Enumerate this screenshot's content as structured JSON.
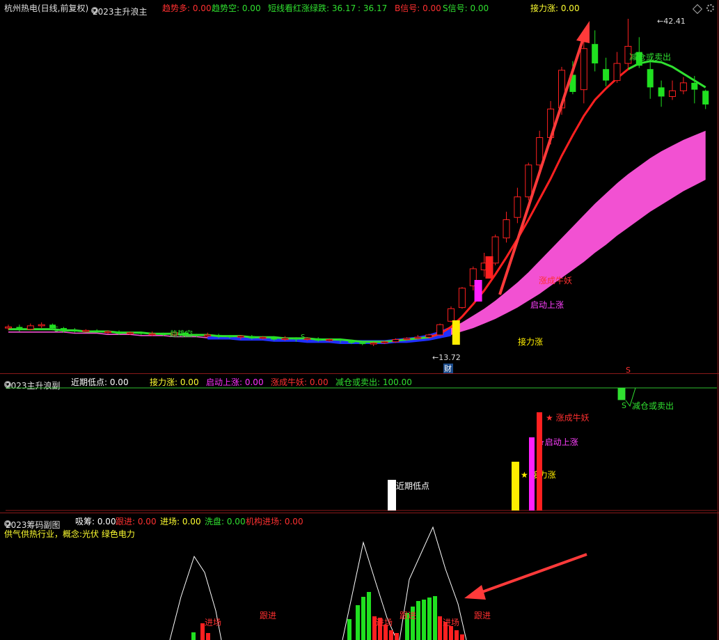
{
  "pane_main": {
    "title": "杭州热电(日线,前复权)",
    "indicator": "2023主升浪主",
    "fields": [
      {
        "label": "趋势多: 0.00",
        "color": "#ff3030"
      },
      {
        "label": "趋势空: 0.00",
        "color": "#30e030"
      },
      {
        "label": "短线看红涨绿跌: 36.17",
        "color": "#30e030"
      },
      {
        "label": ": 36.17",
        "color": "#30e030"
      },
      {
        "label": "B信号: 0.00",
        "color": "#ff3030"
      },
      {
        "label": "S信号: 0.00",
        "color": "#30e030"
      },
      {
        "label": "接力涨: 0.00",
        "color": "#ffff30"
      }
    ],
    "high_label": "42.41",
    "low_label": "13.72",
    "cai_label": "财",
    "annotations": {
      "jieli": "接力涨",
      "qidong": "启动上涨",
      "zhangcheng": "涨成牛妖",
      "jiancang": "减仓或卖出",
      "qushi_kong": "趋势空",
      "s_mark": "S",
      "s_mark2": "S"
    }
  },
  "pane_mid": {
    "indicator": "2023主升浪副",
    "fields": [
      {
        "label": "近期低点: 0.00",
        "color": "#ffffff"
      },
      {
        "label": "接力涨: 0.00",
        "color": "#ffff30"
      },
      {
        "label": "启动上涨: 0.00",
        "color": "#ff30ff"
      },
      {
        "label": "涨成牛妖: 0.00",
        "color": "#ff3030"
      },
      {
        "label": "减仓或卖出: 100.00",
        "color": "#30e030"
      }
    ],
    "bar_labels": {
      "low": "近期低点",
      "jieli": "★ 接力涨",
      "qidong": "★启动上涨",
      "zhangcheng": "★ 涨成牛妖",
      "jiancang": "减仓或卖出",
      "s": "S"
    }
  },
  "pane_low": {
    "indicator": "2023筹码副图",
    "fields": [
      {
        "label": "吸筹: 0.00",
        "color": "#ffffff"
      },
      {
        "label": "跟进: 0.00",
        "color": "#ff3030"
      },
      {
        "label": "进场: 0.00",
        "color": "#ffff30"
      },
      {
        "label": "洗盘: 0.00",
        "color": "#30e030"
      },
      {
        "label": "机构进场: 0.00",
        "color": "#ff3030"
      }
    ],
    "concept": "供气供热行业，概念:光伏 绿色电力",
    "marks": {
      "jinchang": "进场",
      "genjin": "跟进"
    }
  },
  "chart_data": {
    "type": "candlestick",
    "title": "杭州热电(日线,前复权)",
    "y_low": 13.72,
    "y_high": 42.41,
    "colors": {
      "up": "#ff2020",
      "down": "#20e020",
      "pink": "#ff55dd",
      "blue": "#2030ff",
      "yellow": "#ffee00",
      "magenta": "#ff20ff"
    },
    "candles": [
      {
        "o": 15.3,
        "c": 15.4,
        "h": 15.6,
        "l": 15.1
      },
      {
        "o": 15.4,
        "c": 15.2,
        "h": 15.6,
        "l": 15.0
      },
      {
        "o": 15.2,
        "c": 15.5,
        "h": 15.7,
        "l": 15.1
      },
      {
        "o": 15.5,
        "c": 15.6,
        "h": 15.8,
        "l": 15.3
      },
      {
        "o": 15.6,
        "c": 15.3,
        "h": 15.7,
        "l": 15.1
      },
      {
        "o": 15.3,
        "c": 15.1,
        "h": 15.4,
        "l": 14.9
      },
      {
        "o": 15.1,
        "c": 15.0,
        "h": 15.3,
        "l": 14.9
      },
      {
        "o": 15.0,
        "c": 15.1,
        "h": 15.2,
        "l": 14.9
      },
      {
        "o": 15.1,
        "c": 15.0,
        "h": 15.2,
        "l": 14.9
      },
      {
        "o": 15.0,
        "c": 15.0,
        "h": 15.1,
        "l": 14.8
      },
      {
        "o": 15.0,
        "c": 14.8,
        "h": 15.1,
        "l": 14.7
      },
      {
        "o": 14.8,
        "c": 14.9,
        "h": 15.0,
        "l": 14.7
      },
      {
        "o": 14.9,
        "c": 14.8,
        "h": 15.0,
        "l": 14.7
      },
      {
        "o": 14.8,
        "c": 14.8,
        "h": 15.0,
        "l": 14.6
      },
      {
        "o": 14.8,
        "c": 14.7,
        "h": 14.9,
        "l": 14.6
      },
      {
        "o": 14.7,
        "c": 14.9,
        "h": 15.0,
        "l": 14.6
      },
      {
        "o": 14.9,
        "c": 14.7,
        "h": 15.0,
        "l": 14.5
      },
      {
        "o": 14.7,
        "c": 14.6,
        "h": 14.8,
        "l": 14.5
      },
      {
        "o": 14.6,
        "c": 14.7,
        "h": 14.9,
        "l": 14.5
      },
      {
        "o": 14.7,
        "c": 14.6,
        "h": 14.8,
        "l": 14.4
      },
      {
        "o": 14.6,
        "c": 14.5,
        "h": 14.7,
        "l": 14.4
      },
      {
        "o": 14.5,
        "c": 14.6,
        "h": 14.7,
        "l": 14.3
      },
      {
        "o": 14.6,
        "c": 14.4,
        "h": 14.7,
        "l": 14.3
      },
      {
        "o": 14.4,
        "c": 14.5,
        "h": 14.6,
        "l": 14.3
      },
      {
        "o": 14.5,
        "c": 14.3,
        "h": 14.6,
        "l": 14.2
      },
      {
        "o": 14.3,
        "c": 14.4,
        "h": 14.6,
        "l": 14.2
      },
      {
        "o": 14.4,
        "c": 14.3,
        "h": 14.5,
        "l": 14.1
      },
      {
        "o": 14.3,
        "c": 14.4,
        "h": 14.5,
        "l": 14.2
      },
      {
        "o": 14.4,
        "c": 14.2,
        "h": 14.5,
        "l": 14.1
      },
      {
        "o": 14.2,
        "c": 14.3,
        "h": 14.4,
        "l": 14.1
      },
      {
        "o": 14.3,
        "c": 14.2,
        "h": 14.4,
        "l": 14.0
      },
      {
        "o": 14.2,
        "c": 14.0,
        "h": 14.3,
        "l": 13.9
      },
      {
        "o": 14.0,
        "c": 13.9,
        "h": 14.1,
        "l": 13.8
      },
      {
        "o": 13.9,
        "c": 14.0,
        "h": 14.1,
        "l": 13.72
      },
      {
        "o": 14.0,
        "c": 14.1,
        "h": 14.2,
        "l": 13.9
      },
      {
        "o": 14.1,
        "c": 14.3,
        "h": 14.4,
        "l": 14.0
      },
      {
        "o": 14.3,
        "c": 14.4,
        "h": 14.5,
        "l": 14.2
      },
      {
        "o": 14.4,
        "c": 14.5,
        "h": 14.7,
        "l": 14.3
      },
      {
        "o": 14.5,
        "c": 14.7,
        "h": 14.8,
        "l": 14.4
      },
      {
        "o": 14.7,
        "c": 15.6,
        "h": 15.7,
        "l": 14.6
      },
      {
        "o": 15.9,
        "c": 17.0,
        "h": 17.2,
        "l": 15.8
      },
      {
        "o": 17.1,
        "c": 18.8,
        "h": 18.9,
        "l": 17.0
      },
      {
        "o": 19.0,
        "c": 20.5,
        "h": 20.7,
        "l": 18.6
      },
      {
        "o": 20.4,
        "c": 21.0,
        "h": 21.9,
        "l": 19.8
      },
      {
        "o": 21.0,
        "c": 23.3,
        "h": 23.5,
        "l": 20.8
      },
      {
        "o": 23.2,
        "c": 24.8,
        "h": 25.5,
        "l": 22.8
      },
      {
        "o": 25.0,
        "c": 26.8,
        "h": 27.6,
        "l": 24.5
      },
      {
        "o": 26.8,
        "c": 29.6,
        "h": 29.8,
        "l": 26.5
      },
      {
        "o": 29.6,
        "c": 32.0,
        "h": 32.6,
        "l": 29.0
      },
      {
        "o": 32.0,
        "c": 34.5,
        "h": 35.2,
        "l": 31.4
      },
      {
        "o": 34.6,
        "c": 37.9,
        "h": 38.2,
        "l": 34.0
      },
      {
        "o": 37.5,
        "c": 36.0,
        "h": 38.7,
        "l": 35.8
      },
      {
        "o": 36.2,
        "c": 39.8,
        "h": 41.3,
        "l": 35.0
      },
      {
        "o": 40.2,
        "c": 38.5,
        "h": 41.4,
        "l": 37.8
      },
      {
        "o": 38.0,
        "c": 37.0,
        "h": 39.0,
        "l": 36.5
      },
      {
        "o": 37.0,
        "c": 38.5,
        "h": 39.5,
        "l": 36.8
      },
      {
        "o": 38.5,
        "c": 40.0,
        "h": 42.41,
        "l": 38.0
      },
      {
        "o": 39.5,
        "c": 38.3,
        "h": 40.8,
        "l": 38.1
      },
      {
        "o": 38.0,
        "c": 36.4,
        "h": 38.6,
        "l": 35.4
      },
      {
        "o": 36.4,
        "c": 35.6,
        "h": 37.0,
        "l": 34.7
      },
      {
        "o": 35.6,
        "c": 36.1,
        "h": 37.0,
        "l": 35.3
      },
      {
        "o": 36.1,
        "c": 36.8,
        "h": 37.3,
        "l": 35.8
      },
      {
        "o": 36.8,
        "c": 36.2,
        "h": 37.4,
        "l": 35.0
      },
      {
        "o": 36.1,
        "c": 34.9,
        "h": 36.2,
        "l": 34.5
      }
    ],
    "ma": [
      15.2,
      15.2,
      15.2,
      15.2,
      15.2,
      15.1,
      15.1,
      15.0,
      15.0,
      15.0,
      14.9,
      14.9,
      14.9,
      14.8,
      14.8,
      14.8,
      14.7,
      14.7,
      14.7,
      14.6,
      14.6,
      14.6,
      14.5,
      14.5,
      14.5,
      14.4,
      14.4,
      14.4,
      14.3,
      14.3,
      14.3,
      14.2,
      14.1,
      14.1,
      14.1,
      14.2,
      14.3,
      14.4,
      14.5,
      14.8,
      15.4,
      16.3,
      17.4,
      18.6,
      20.0,
      21.5,
      23.1,
      24.8,
      26.6,
      28.4,
      30.4,
      32.2,
      33.9,
      35.3,
      36.3,
      37.2,
      38.0,
      38.5,
      38.7,
      38.6,
      38.2,
      37.6,
      37.0,
      36.4
    ],
    "pink_upper": [
      15.0,
      15.0,
      15.0,
      15.0,
      15.0,
      15.0,
      14.9,
      14.9,
      14.9,
      14.8,
      14.8,
      14.8,
      14.7,
      14.7,
      14.7,
      14.6,
      14.6,
      14.6,
      14.5,
      14.5,
      14.5,
      14.4,
      14.4,
      14.4,
      14.3,
      14.3,
      14.3,
      14.2,
      14.2,
      14.2,
      14.1,
      14.1,
      14.1,
      14.1,
      14.1,
      14.2,
      14.3,
      14.4,
      14.6,
      14.9,
      15.3,
      15.8,
      16.4,
      17.0,
      17.7,
      18.5,
      19.3,
      20.2,
      21.2,
      22.2,
      23.2,
      24.2,
      25.2,
      26.2,
      27.1,
      28.0,
      28.8,
      29.5,
      30.2,
      30.8,
      31.3,
      31.8,
      32.2,
      32.6
    ],
    "pink_lower": [
      14.9,
      14.9,
      14.9,
      14.9,
      14.9,
      14.9,
      14.8,
      14.8,
      14.8,
      14.7,
      14.7,
      14.7,
      14.6,
      14.6,
      14.6,
      14.5,
      14.5,
      14.5,
      14.4,
      14.4,
      14.4,
      14.3,
      14.3,
      14.3,
      14.2,
      14.2,
      14.2,
      14.1,
      14.1,
      14.1,
      14.0,
      14.0,
      14.0,
      14.0,
      14.0,
      14.1,
      14.1,
      14.2,
      14.3,
      14.5,
      14.7,
      15.0,
      15.3,
      15.7,
      16.1,
      16.6,
      17.1,
      17.7,
      18.3,
      19.0,
      19.7,
      20.4,
      21.1,
      21.9,
      22.6,
      23.4,
      24.1,
      24.8,
      25.5,
      26.1,
      26.7,
      27.3,
      27.8,
      28.3
    ]
  }
}
